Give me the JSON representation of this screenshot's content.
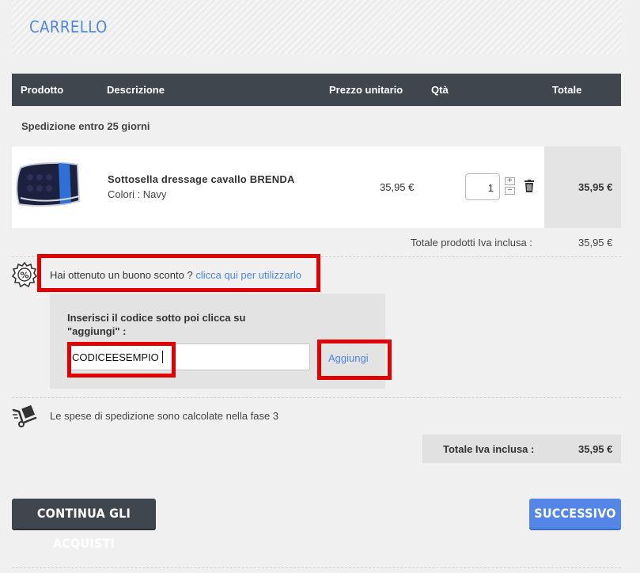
{
  "page": {
    "title": "CARRELLO"
  },
  "table": {
    "headers": {
      "product": "Prodotto",
      "description": "Descrizione",
      "unit_price": "Prezzo unitario",
      "qty": "Qtà",
      "total": "Totale"
    },
    "shipping_time": "Spedizione entro 25 giorni"
  },
  "item": {
    "name": "Sottosella dressage cavallo BRENDA",
    "color": "Colori : Navy",
    "unit_price": "35,95 €",
    "quantity": "1",
    "total": "35,95 €",
    "icons": {
      "increase": "plus-icon",
      "decrease": "minus-icon",
      "remove": "trash-icon"
    }
  },
  "subtotal": {
    "label": "Totale prodotti Iva inclusa :",
    "value": "35,95 €"
  },
  "coupon": {
    "question": "Hai ottenuto un buono sconto ?",
    "link": "clicca qui per utilizzarlo",
    "instruction": "Inserisci il codice sotto poi clicca su \"aggiungi\" :",
    "code_value": "CODICEESEMPIO",
    "add_label": "Aggiungi",
    "icon": "discount-badge-icon",
    "highlight_color": "#e10000"
  },
  "shipping": {
    "note": "Le spese di spedizione sono calcolate nella fase 3",
    "icon": "delivery-truck-icon"
  },
  "grand_total": {
    "label": "Totale Iva inclusa :",
    "value": "35,95 €"
  },
  "buttons": {
    "continue": "CONTINUA GLI ACQUISTI",
    "next": "SUCCESSIVO"
  },
  "colors": {
    "accent": "#4e86e0",
    "header_bg": "#3f464d",
    "next_button": "#5486e7"
  }
}
